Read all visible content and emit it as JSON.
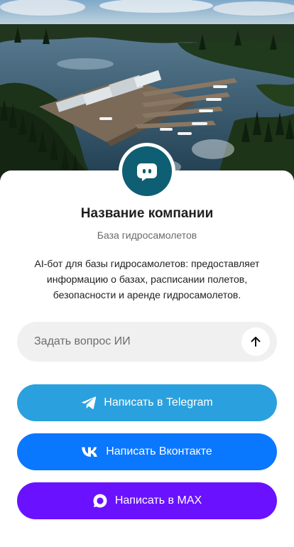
{
  "company": {
    "name": "Название компании",
    "category": "База гидросамолетов",
    "description": "AI-бот для базы гидросамолетов: предоставляет информацию о базах, расписании полетов, безопасности и аренде гидросамолетов."
  },
  "ask": {
    "placeholder": "Задать вопрос ИИ",
    "send_icon": "arrow-up-icon"
  },
  "buttons": [
    {
      "label": "Написать в Telegram",
      "icon": "telegram-icon",
      "color": "#2aa1de"
    },
    {
      "label": "Написать Вконтакте",
      "icon": "vk-icon",
      "color": "#0a77ff"
    },
    {
      "label": "Написать в MAX",
      "icon": "max-icon",
      "color": "#6a12ff"
    }
  ],
  "colors": {
    "avatar_bg": "#0e5f73",
    "input_bg": "#f0f0f0",
    "text": "#1f1f1f",
    "muted": "#6b6b6b"
  },
  "avatar_icon": "chat-bot-icon",
  "hero_image": "aerial-lake-seaplane-base"
}
